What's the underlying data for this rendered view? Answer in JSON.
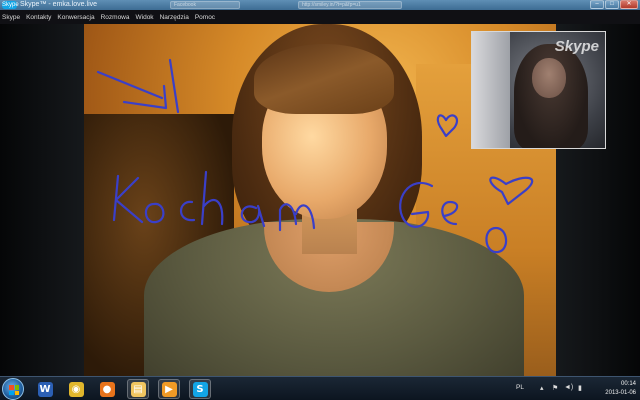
{
  "window": {
    "title": "Skype™ - emka.love.live",
    "app_badge": "Skype",
    "ghost_tabs": [
      "Facebook",
      "http://smiley.in/?t=p&fp=u1"
    ]
  },
  "menu": {
    "items": [
      "Skype",
      "Kontakty",
      "Konwersacja",
      "Rozmowa",
      "Widok",
      "Narzędzia",
      "Pomoc"
    ]
  },
  "call": {
    "preview_logo": "Skype",
    "drawing_ink_color": "#3a3fc8"
  },
  "taskbar": {
    "apps": [
      {
        "name": "word-icon",
        "glyph": "W",
        "color": "#2b5fb4"
      },
      {
        "name": "chrome-icon",
        "glyph": "◉",
        "color": "#e0b62c"
      },
      {
        "name": "firefox-icon",
        "glyph": "●",
        "color": "#e8731b"
      },
      {
        "name": "explorer-icon",
        "glyph": "▤",
        "color": "#f0c560"
      },
      {
        "name": "media-player-icon",
        "glyph": "▶",
        "color": "#f09a26"
      },
      {
        "name": "skype-icon",
        "glyph": "S",
        "color": "#12a5e6"
      }
    ],
    "language": "PL",
    "time": "00:14",
    "date": "2013-01-06"
  }
}
